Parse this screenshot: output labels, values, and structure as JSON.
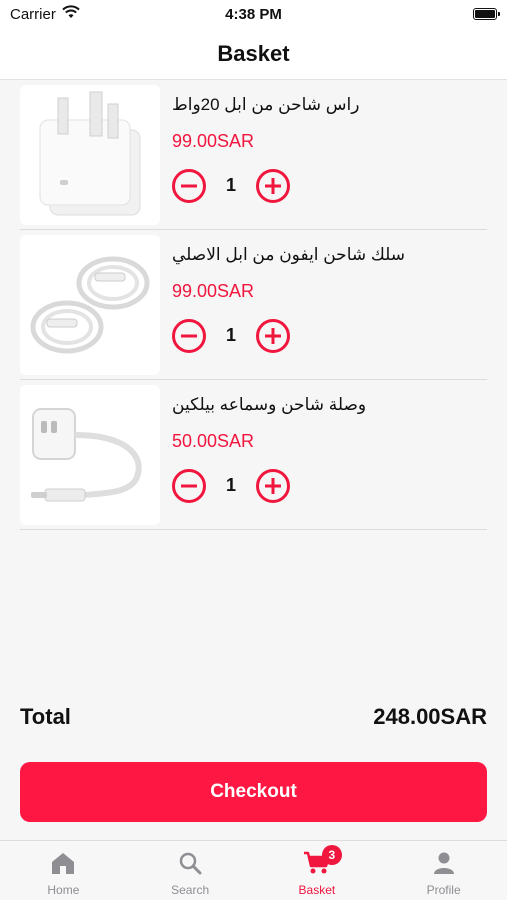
{
  "status_bar": {
    "carrier": "Carrier",
    "time": "4:38 PM"
  },
  "nav": {
    "title": "Basket"
  },
  "items": [
    {
      "name": "راس شاحن من ابل 20واط",
      "price": "99.00SAR",
      "quantity": "1",
      "image_icon": "power-adapter-icon"
    },
    {
      "name": "سلك شاحن ايفون من ابل الاصلي",
      "price": "99.00SAR",
      "quantity": "1",
      "image_icon": "charging-cable-icon"
    },
    {
      "name": "وصلة شاحن وسماعه بيلكين",
      "price": "50.00SAR",
      "quantity": "1",
      "image_icon": "adapter-dongle-icon"
    }
  ],
  "summary": {
    "total_label": "Total",
    "total_value": "248.00SAR"
  },
  "checkout": {
    "label": "Checkout"
  },
  "tabs": [
    {
      "label": "Home",
      "icon": "home-icon"
    },
    {
      "label": "Search",
      "icon": "search-icon"
    },
    {
      "label": "Basket",
      "icon": "cart-icon",
      "badge": "3"
    },
    {
      "label": "Profile",
      "icon": "profile-icon"
    }
  ],
  "colors": {
    "accent": "#f0163e",
    "checkout": "#ff1744",
    "tab_inactive": "#8e8e93"
  }
}
